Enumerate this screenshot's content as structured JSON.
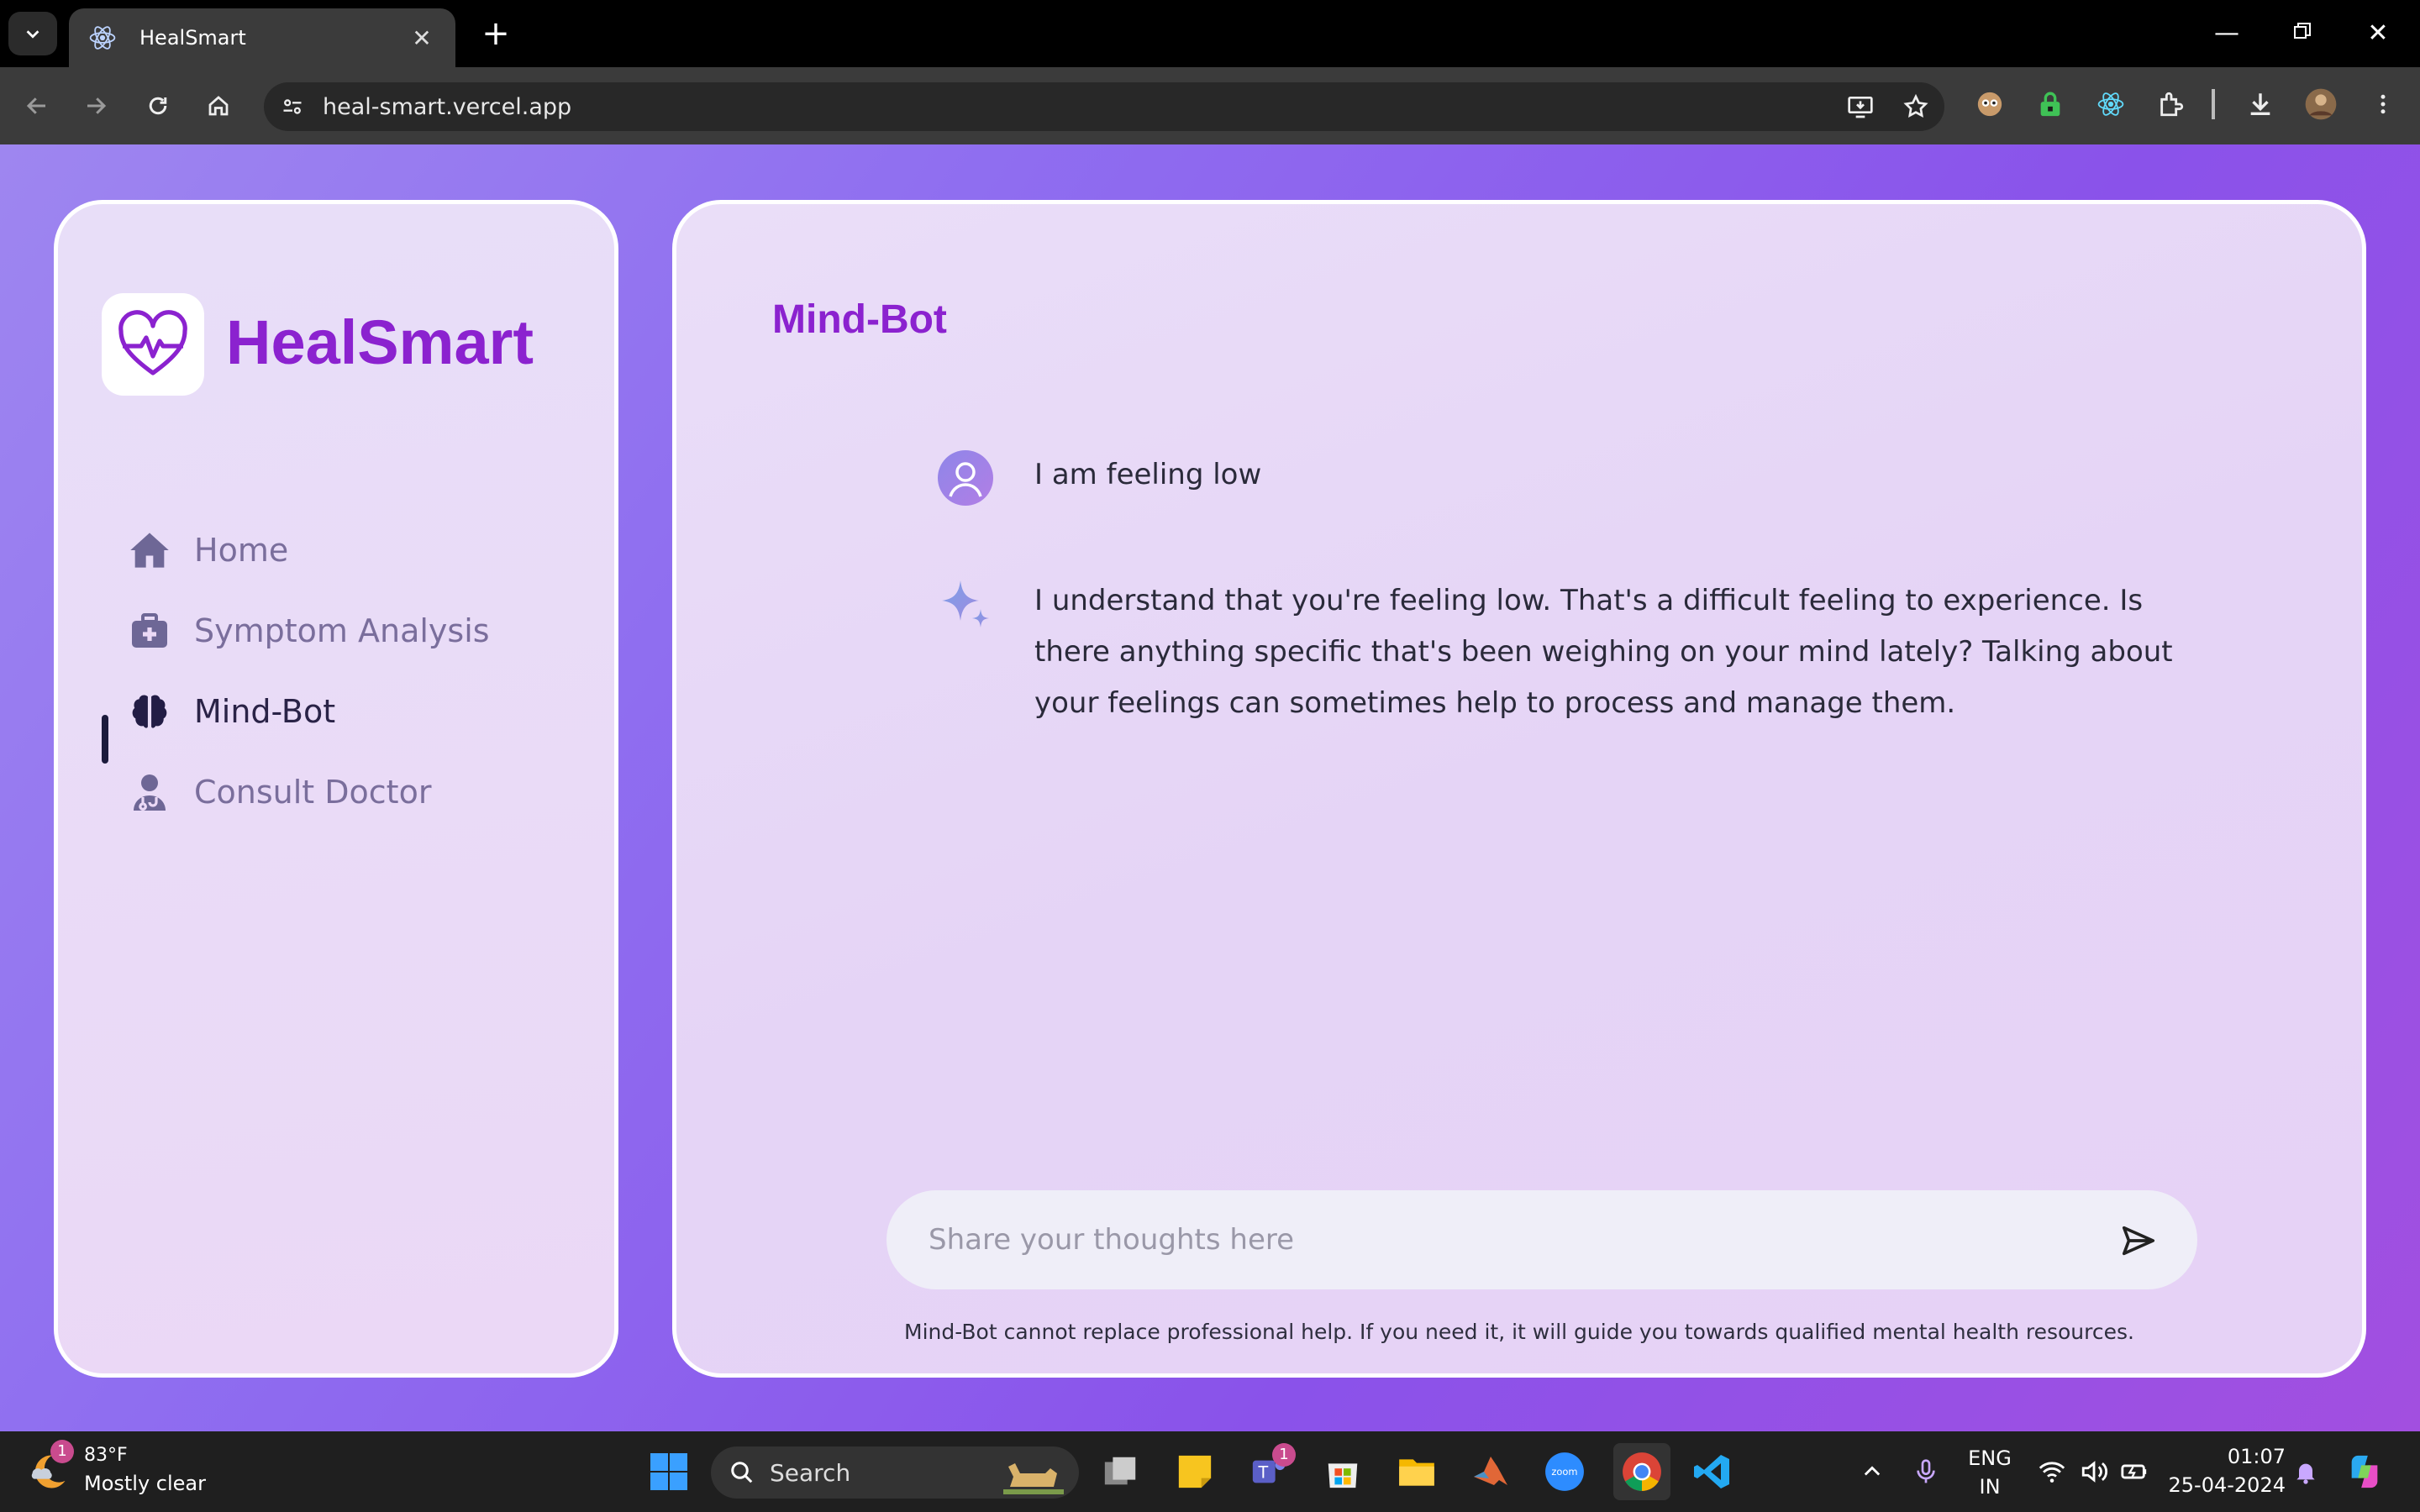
{
  "browser": {
    "tab_title": "HealSmart",
    "url": "heal-smart.vercel.app",
    "new_tab_label": "+"
  },
  "sidebar": {
    "brand": "HealSmart",
    "items": [
      {
        "label": "Home",
        "icon": "home-icon"
      },
      {
        "label": "Symptom Analysis",
        "icon": "medical-kit-icon"
      },
      {
        "label": "Mind-Bot",
        "icon": "brain-icon",
        "active": true
      },
      {
        "label": "Consult Doctor",
        "icon": "doctor-icon"
      }
    ]
  },
  "main": {
    "title": "Mind-Bot",
    "messages": [
      {
        "role": "user",
        "text": "I am feeling low"
      },
      {
        "role": "bot",
        "text": "I understand that you're feeling low. That's a difficult feeling to experience. Is there anything specific that's been weighing on your mind lately? Talking about your feelings can sometimes help to process and manage them."
      }
    ],
    "input_placeholder": "Share your thoughts here",
    "disclaimer": "Mind-Bot cannot replace professional help. If you need it, it will guide you towards qualified mental health resources."
  },
  "taskbar": {
    "weather_temp": "83°F",
    "weather_desc": "Mostly clear",
    "weather_badge": "1",
    "search_label": "Search",
    "teams_badge": "1",
    "lang_line1": "ENG",
    "lang_line2": "IN",
    "time": "01:07",
    "date": "25-04-2024"
  },
  "colors": {
    "brand": "#8b22cf",
    "page_gradient_start": "#9e86f0",
    "page_gradient_end": "#a24fe0",
    "nav_inactive": "#7a6e9c",
    "nav_active": "#2a2347"
  }
}
